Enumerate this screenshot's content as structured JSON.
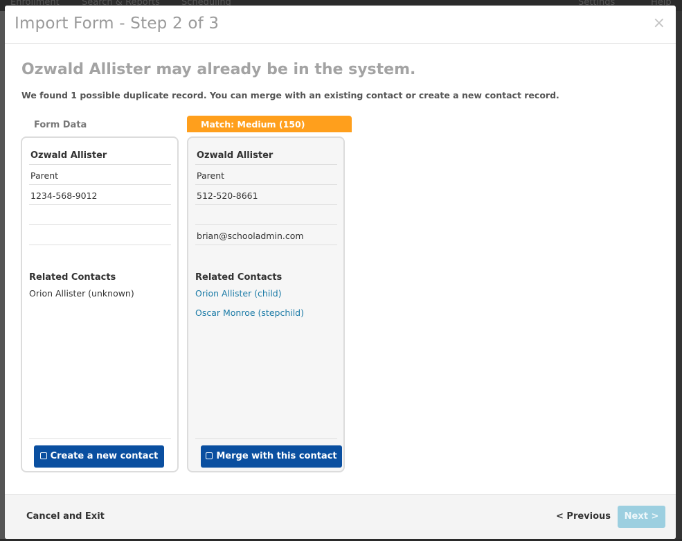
{
  "background": {
    "nav_items": [
      "Enrollment",
      "Search & Reports",
      "Scheduling",
      "Settings",
      "Help"
    ]
  },
  "modal": {
    "title": "Import Form - Step 2 of 3",
    "close_icon": "×",
    "heading": "Ozwald Allister may already be in the system.",
    "subtext": "We found 1 possible duplicate record. You can merge with an existing contact or create a new contact record.",
    "form_column": {
      "label": "Form Data",
      "name": "Ozwald Allister",
      "role": "Parent",
      "phone": "1234-568-9012",
      "field4": "",
      "field5": "",
      "related_title": "Related Contacts",
      "related": [
        "Orion Allister (unknown)"
      ],
      "button_label": "Create a new contact"
    },
    "match_column": {
      "badge": "Match: Medium (150)",
      "name": "Ozwald Allister",
      "role": "Parent",
      "phone": "512-520-8661",
      "field4": "",
      "email": "brian@schooladmin.com",
      "related_title": "Related Contacts",
      "related": [
        "Orion Allister (child)",
        "Oscar Monroe (stepchild)"
      ],
      "button_label": "Merge with this contact"
    },
    "footer": {
      "cancel_label": "Cancel and Exit",
      "previous_label": "< Previous",
      "next_label": "Next >"
    }
  },
  "colors": {
    "primary_button": "#0a4fa0",
    "match_badge": "#ff9f1c",
    "link": "#1a7aa6",
    "next_disabled": "#9ccfe0"
  },
  "icons": {
    "close": "close-icon",
    "checkbox": "checkbox-icon"
  }
}
